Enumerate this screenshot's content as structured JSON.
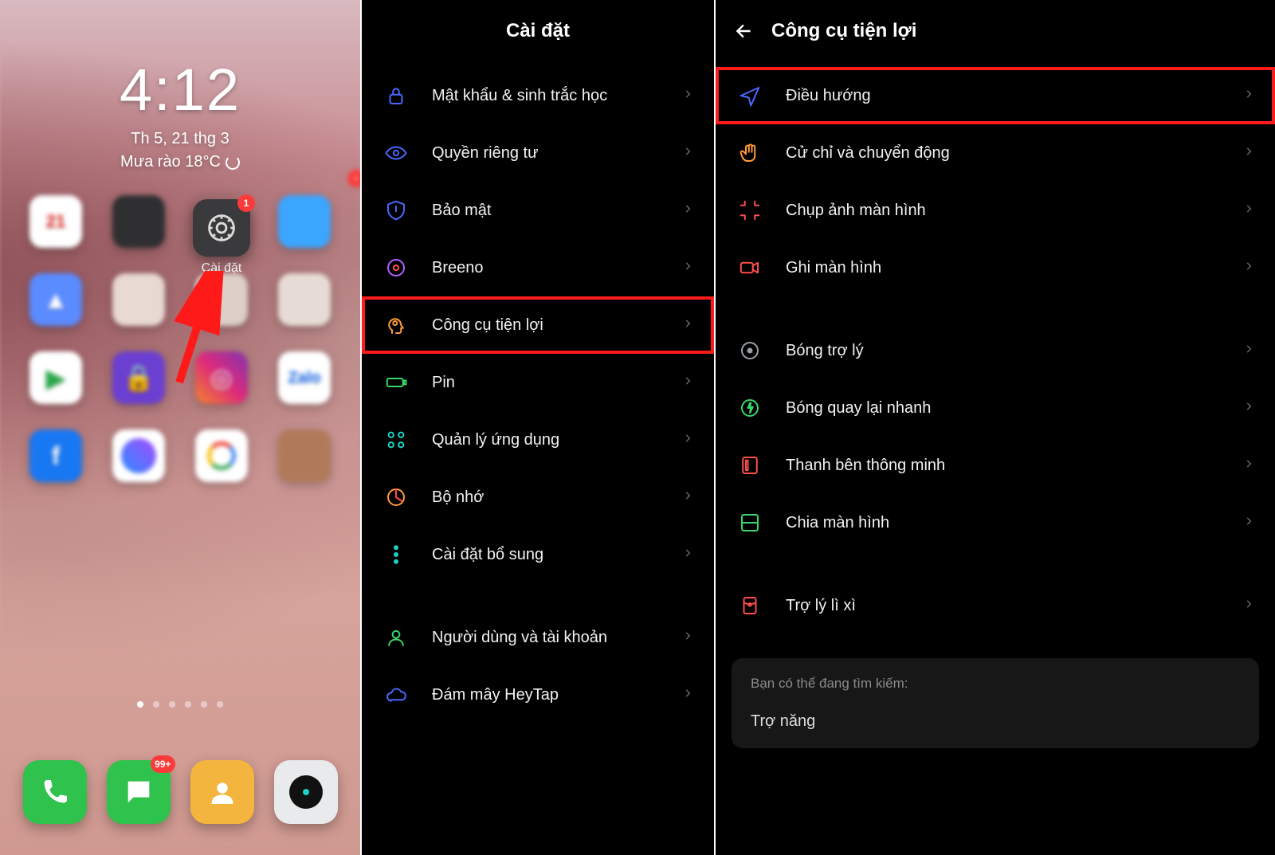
{
  "homescreen": {
    "time": "4:12",
    "date": "Th 5, 21 thg 3",
    "weather": "Mưa rào 18°C",
    "settings_label": "Cài đặt",
    "settings_badge": "1",
    "dock_badge_messages": "99+"
  },
  "settings_panel": {
    "title": "Cài đặt",
    "items": [
      {
        "label": "Mật khẩu & sinh trắc học",
        "icon": "lock-icon"
      },
      {
        "label": "Quyền riêng tư",
        "icon": "eye-icon"
      },
      {
        "label": "Bảo mật",
        "icon": "shield-icon"
      },
      {
        "label": "Breeno",
        "icon": "circle-icon"
      },
      {
        "label": "Công cụ tiện lợi",
        "icon": "tools-head-icon",
        "highlight": true
      },
      {
        "label": "Pin",
        "icon": "battery-icon"
      },
      {
        "label": "Quản lý ứng dụng",
        "icon": "apps-icon"
      },
      {
        "label": "Bộ nhớ",
        "icon": "storage-pie-icon"
      },
      {
        "label": "Cài đặt bổ sung",
        "icon": "more-dots-icon"
      },
      {
        "label": "Người dùng và tài khoản",
        "icon": "user-icon"
      },
      {
        "label": "Đám mây HeyTap",
        "icon": "cloud-icon"
      }
    ]
  },
  "tools_panel": {
    "title": "Công cụ tiện lợi",
    "groups": [
      [
        {
          "label": "Điều hướng",
          "icon": "navigate-icon",
          "highlight": true
        },
        {
          "label": "Cử chỉ và chuyển động",
          "icon": "hand-icon"
        },
        {
          "label": "Chụp ảnh màn hình",
          "icon": "screenshot-icon"
        },
        {
          "label": "Ghi màn hình",
          "icon": "record-icon"
        }
      ],
      [
        {
          "label": "Bóng trợ lý",
          "icon": "assistive-ball-icon"
        },
        {
          "label": "Bóng quay lại nhanh",
          "icon": "flash-ball-icon"
        },
        {
          "label": "Thanh bên thông minh",
          "icon": "sidebar-icon"
        },
        {
          "label": "Chia màn hình",
          "icon": "split-icon"
        }
      ],
      [
        {
          "label": "Trợ lý lì xì",
          "icon": "red-envelope-icon"
        }
      ]
    ],
    "search_hint_caption": "Bạn có thể đang tìm kiếm:",
    "search_hint_term": "Trợ năng"
  }
}
